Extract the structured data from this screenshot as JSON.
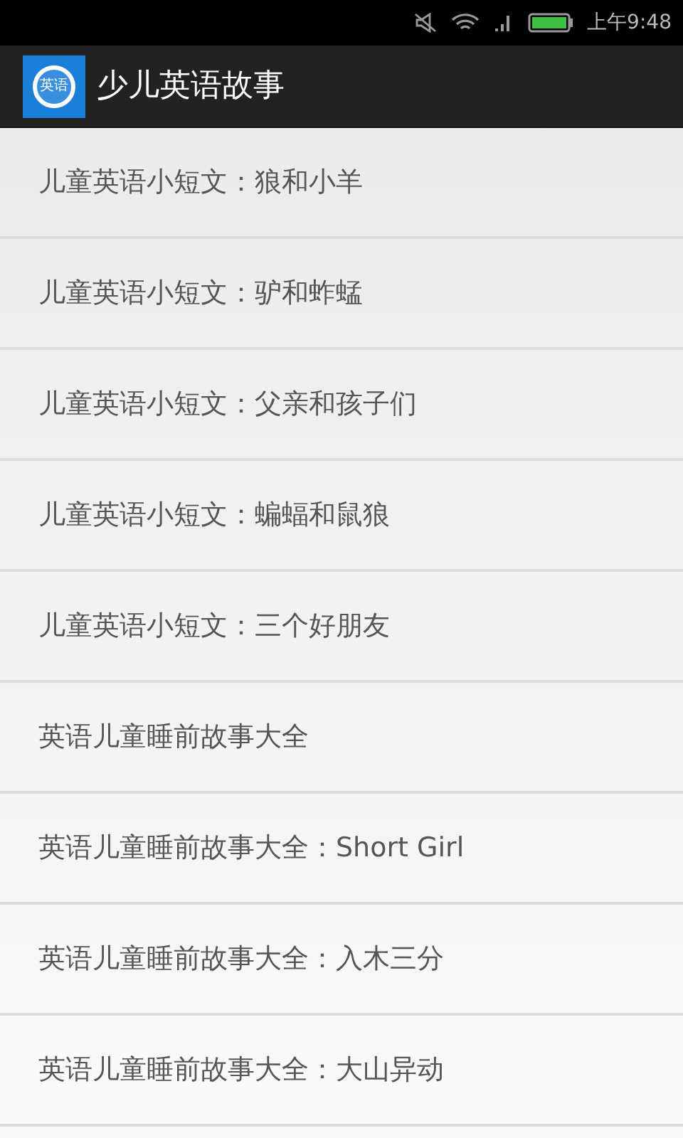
{
  "status_bar": {
    "time": "上午9:48"
  },
  "action_bar": {
    "app_icon_label": "英语",
    "title": "少儿英语故事"
  },
  "stories": [
    {
      "title": "儿童英语小短文：狼和小羊"
    },
    {
      "title": "儿童英语小短文：驴和蚱蜢"
    },
    {
      "title": "儿童英语小短文：父亲和孩子们"
    },
    {
      "title": "儿童英语小短文：蝙蝠和鼠狼"
    },
    {
      "title": "儿童英语小短文：三个好朋友"
    },
    {
      "title": "英语儿童睡前故事大全"
    },
    {
      "title": "英语儿童睡前故事大全：Short Girl"
    },
    {
      "title": "英语儿童睡前故事大全：入木三分"
    },
    {
      "title": "英语儿童睡前故事大全：大山异动"
    }
  ]
}
